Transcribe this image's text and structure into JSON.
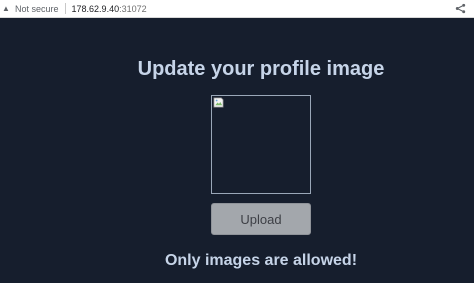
{
  "browser": {
    "lock_icon": "warning-icon",
    "security_label": "Not secure",
    "url_host": "178.62.9.40",
    "url_port": ":31072",
    "share_icon": "share-icon"
  },
  "page": {
    "title": "Update your profile image",
    "image_icon": "broken-image-icon",
    "upload_label": "Upload",
    "status_message": "Only images are allowed!"
  },
  "colors": {
    "page_background": "#161e2d",
    "heading_text": "#c6d4e8",
    "button_background": "#a3a7ac"
  }
}
